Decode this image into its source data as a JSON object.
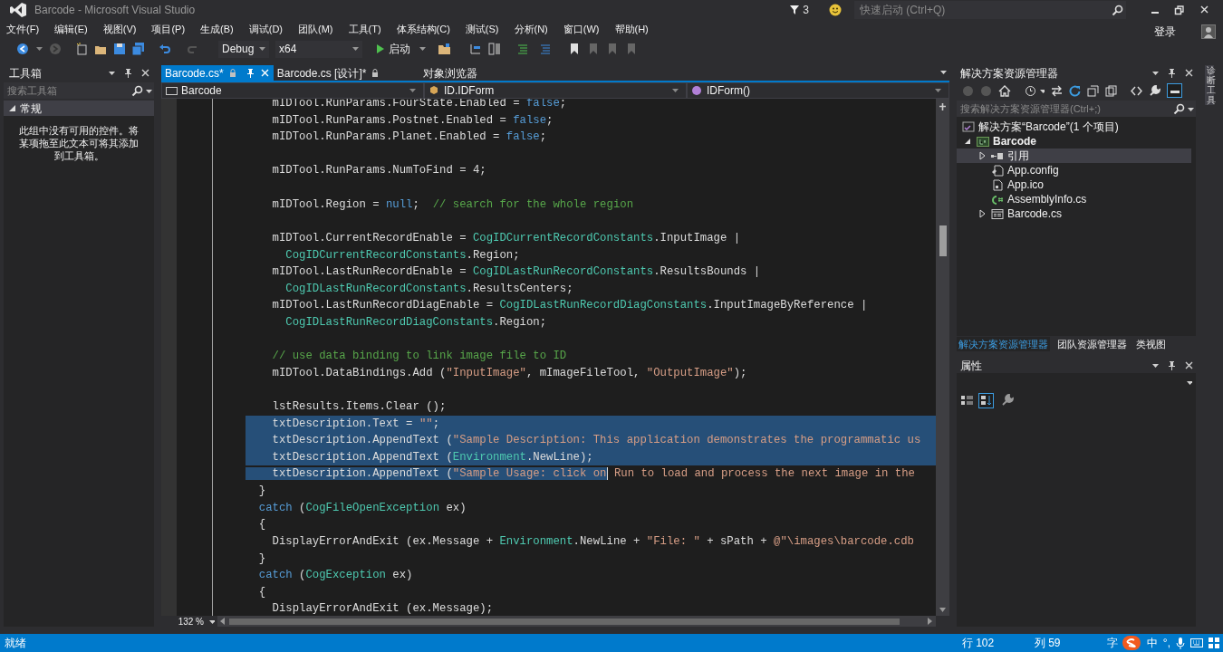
{
  "window": {
    "title": "Barcode - Microsoft Visual Studio"
  },
  "notifications": {
    "count": "3"
  },
  "quick_launch": {
    "placeholder": "快速启动 (Ctrl+Q)"
  },
  "menu": [
    "文件(F)",
    "编辑(E)",
    "视图(V)",
    "项目(P)",
    "生成(B)",
    "调试(D)",
    "团队(M)",
    "工具(T)",
    "体系结构(C)",
    "测试(S)",
    "分析(N)",
    "窗口(W)",
    "帮助(H)"
  ],
  "account": {
    "label": "登录"
  },
  "toolbar": {
    "configuration": "Debug",
    "platform": "x64",
    "start": "启动"
  },
  "toolbox": {
    "title": "工具箱",
    "search": {
      "placeholder": "搜索工具箱"
    },
    "groups": [
      {
        "label": "常规",
        "expanded": true,
        "message": "此组中没有可用的控件。将某项拖至此文本可将其添加到工具箱。"
      }
    ]
  },
  "editor": {
    "tabs": [
      {
        "label": "Barcode.cs*",
        "selected": true,
        "locked": true
      },
      {
        "label": "Barcode.cs [设计]*",
        "selected": false,
        "locked": true
      },
      {
        "label": "对象浏览器",
        "selected": false,
        "locked": false
      }
    ],
    "nav": [
      "Barcode",
      "ID.IDForm",
      "IDForm()"
    ],
    "lines": [
      {
        "selected": false,
        "blank_before": false,
        "tokens": [
          {
            "text": "    mIDTool.RunParams.FourState.Enabled = ",
            "kind": "plain"
          },
          {
            "text": "false",
            "kind": "keyword"
          },
          {
            "text": ";",
            "kind": "plain"
          }
        ]
      },
      {
        "selected": false,
        "blank_before": false,
        "tokens": [
          {
            "text": "    mIDTool.RunParams.Postnet.Enabled = ",
            "kind": "plain"
          },
          {
            "text": "false",
            "kind": "keyword"
          },
          {
            "text": ";",
            "kind": "plain"
          }
        ]
      },
      {
        "selected": false,
        "blank_before": false,
        "tokens": [
          {
            "text": "    mIDTool.RunParams.Planet.Enabled = ",
            "kind": "plain"
          },
          {
            "text": "false",
            "kind": "keyword"
          },
          {
            "text": ";",
            "kind": "plain"
          }
        ]
      },
      {
        "selected": false,
        "blank_before": true,
        "tokens": [
          {
            "text": "    mIDTool.RunParams.NumToFind = 4;",
            "kind": "plain"
          }
        ]
      },
      {
        "selected": false,
        "blank_before": true,
        "tokens": [
          {
            "text": "    mIDTool.Region = ",
            "kind": "plain"
          },
          {
            "text": "null",
            "kind": "keyword"
          },
          {
            "text": ";  ",
            "kind": "plain"
          },
          {
            "text": "// search for the whole region",
            "kind": "comment"
          }
        ]
      },
      {
        "selected": false,
        "blank_before": true,
        "tokens": [
          {
            "text": "    mIDTool.CurrentRecordEnable = ",
            "kind": "plain"
          },
          {
            "text": "CogIDCurrentRecordConstants",
            "kind": "type"
          },
          {
            "text": ".InputImage |",
            "kind": "plain"
          }
        ]
      },
      {
        "selected": false,
        "blank_before": false,
        "tokens": [
          {
            "text": "      CogIDCurrentRecordConstants",
            "kind": "type"
          },
          {
            "text": ".Region;",
            "kind": "plain"
          }
        ]
      },
      {
        "selected": false,
        "blank_before": false,
        "tokens": [
          {
            "text": "    mIDTool.LastRunRecordEnable = ",
            "kind": "plain"
          },
          {
            "text": "CogIDLastRunRecordConstants",
            "kind": "type"
          },
          {
            "text": ".ResultsBounds |",
            "kind": "plain"
          }
        ]
      },
      {
        "selected": false,
        "blank_before": false,
        "tokens": [
          {
            "text": "      CogIDLastRunRecordConstants",
            "kind": "type"
          },
          {
            "text": ".ResultsCenters;",
            "kind": "plain"
          }
        ]
      },
      {
        "selected": false,
        "blank_before": false,
        "tokens": [
          {
            "text": "    mIDTool.LastRunRecordDiagEnable = ",
            "kind": "plain"
          },
          {
            "text": "CogIDLastRunRecordDiagConstants",
            "kind": "type"
          },
          {
            "text": ".InputImageByReference |",
            "kind": "plain"
          }
        ]
      },
      {
        "selected": false,
        "blank_before": false,
        "tokens": [
          {
            "text": "      CogIDLastRunRecordDiagConstants",
            "kind": "type"
          },
          {
            "text": ".Region;",
            "kind": "plain"
          }
        ]
      },
      {
        "selected": false,
        "blank_before": true,
        "tokens": [
          {
            "text": "    // use data binding to link image file to ID",
            "kind": "comment"
          }
        ]
      },
      {
        "selected": false,
        "blank_before": false,
        "tokens": [
          {
            "text": "    mIDTool.DataBindings.Add (",
            "kind": "plain"
          },
          {
            "text": "\"InputImage\"",
            "kind": "string"
          },
          {
            "text": ", mImageFileTool, ",
            "kind": "plain"
          },
          {
            "text": "\"OutputImage\"",
            "kind": "string"
          },
          {
            "text": ");",
            "kind": "plain"
          }
        ]
      },
      {
        "selected": false,
        "blank_before": true,
        "tokens": [
          {
            "text": "    lstResults.Items.Clear ();",
            "kind": "plain"
          }
        ]
      },
      {
        "selected": true,
        "blank_before": false,
        "tokens": [
          {
            "text": "    txtDescription.Text = ",
            "kind": "plain"
          },
          {
            "text": "\"\"",
            "kind": "string"
          },
          {
            "text": ";",
            "kind": "plain"
          }
        ]
      },
      {
        "selected": true,
        "blank_before": false,
        "tokens": [
          {
            "text": "    txtDescription.AppendText (",
            "kind": "plain"
          },
          {
            "text": "\"Sample Description: This application demonstrates the programmatic us",
            "kind": "string"
          }
        ]
      },
      {
        "selected": true,
        "blank_before": false,
        "tokens": [
          {
            "text": "    txtDescription.AppendText (",
            "kind": "plain"
          },
          {
            "text": "Environment",
            "kind": "type"
          },
          {
            "text": ".NewLine);",
            "kind": "plain"
          }
        ]
      },
      {
        "selected": true,
        "blank_before": false,
        "caret": true,
        "tokens": [
          {
            "text": "    txtDescription.AppendText (",
            "kind": "plain",
            "selected": true
          },
          {
            "text": "\"Sample Usage: click on",
            "kind": "string",
            "selected": true
          },
          {
            "text": " Run to load and process the next image in the",
            "kind": "string",
            "selected": false
          }
        ]
      },
      {
        "selected": false,
        "blank_before": false,
        "tokens": [
          {
            "text": "  }",
            "kind": "plain"
          }
        ]
      },
      {
        "selected": false,
        "blank_before": false,
        "tokens": [
          {
            "text": "  catch",
            "kind": "keyword"
          },
          {
            "text": " (",
            "kind": "plain"
          },
          {
            "text": "CogFileOpenException",
            "kind": "type"
          },
          {
            "text": " ex)",
            "kind": "plain"
          }
        ]
      },
      {
        "selected": false,
        "blank_before": false,
        "tokens": [
          {
            "text": "  {",
            "kind": "plain"
          }
        ]
      },
      {
        "selected": false,
        "blank_before": false,
        "tokens": [
          {
            "text": "    DisplayErrorAndExit (ex.Message + ",
            "kind": "plain"
          },
          {
            "text": "Environment",
            "kind": "type"
          },
          {
            "text": ".NewLine + ",
            "kind": "plain"
          },
          {
            "text": "\"File: \"",
            "kind": "string"
          },
          {
            "text": " + sPath + ",
            "kind": "plain"
          },
          {
            "text": "@\"\\images\\barcode.cdb",
            "kind": "string"
          }
        ]
      },
      {
        "selected": false,
        "blank_before": false,
        "tokens": [
          {
            "text": "  }",
            "kind": "plain"
          }
        ]
      },
      {
        "selected": false,
        "blank_before": false,
        "tokens": [
          {
            "text": "  catch",
            "kind": "keyword"
          },
          {
            "text": " (",
            "kind": "plain"
          },
          {
            "text": "CogException",
            "kind": "type"
          },
          {
            "text": " ex)",
            "kind": "plain"
          }
        ]
      },
      {
        "selected": false,
        "blank_before": false,
        "tokens": [
          {
            "text": "  {",
            "kind": "plain"
          }
        ]
      },
      {
        "selected": false,
        "blank_before": false,
        "tokens": [
          {
            "text": "    DisplayErrorAndExit (ex.Message);",
            "kind": "plain"
          }
        ]
      }
    ],
    "zoom": "132 %"
  },
  "solution_explorer": {
    "title": "解决方案资源管理器",
    "search": {
      "placeholder": "搜索解决方案资源管理器(Ctrl+;)"
    },
    "tree": [
      {
        "label": "解决方案“Barcode”(1 个项目)",
        "kind": "solution",
        "selected": false,
        "children": [
          {
            "label": "Barcode",
            "kind": "project",
            "selected": false,
            "expanded": true,
            "children": [
              {
                "label": "引用",
                "kind": "references",
                "selected": true,
                "expanded": false
              },
              {
                "label": "App.config",
                "kind": "config",
                "selected": false
              },
              {
                "label": "App.ico",
                "kind": "file",
                "selected": false
              },
              {
                "label": "AssemblyInfo.cs",
                "kind": "csharp",
                "selected": false
              },
              {
                "label": "Barcode.cs",
                "kind": "form",
                "selected": false,
                "expanded": false
              }
            ]
          }
        ]
      }
    ],
    "tabs": [
      {
        "label": "解决方案资源管理器",
        "selected": true
      },
      {
        "label": "团队资源管理器",
        "selected": false
      },
      {
        "label": "类视图",
        "selected": false
      }
    ]
  },
  "properties": {
    "title": "属性"
  },
  "side_strip": {
    "label": "诊断工具"
  },
  "status_bar": {
    "message": "就绪",
    "line": "行 102",
    "column": "列 59",
    "chars": "字"
  },
  "ime": {
    "mode": "中",
    "punctuation": "°,"
  }
}
